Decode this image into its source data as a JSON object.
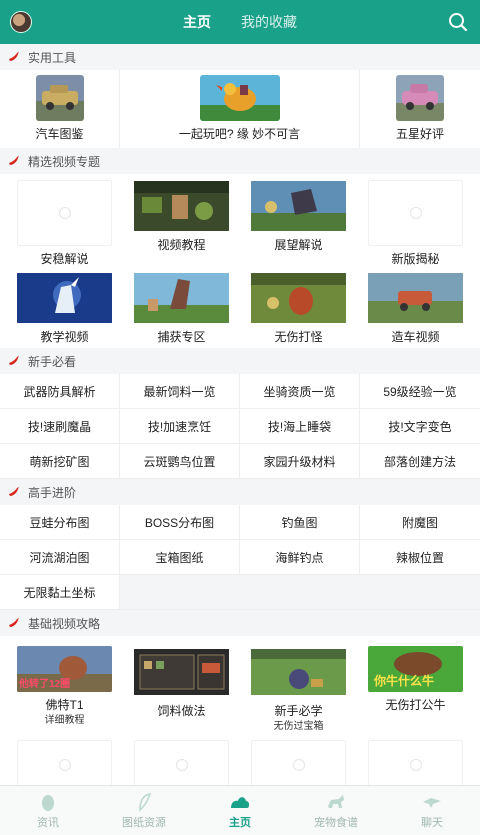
{
  "header": {
    "tabs": [
      {
        "label": "主页"
      },
      {
        "label": "我的收藏"
      }
    ]
  },
  "sections": {
    "tools": {
      "title": "实用工具",
      "items": [
        {
          "label": "汽车图鉴"
        },
        {
          "label": "一起玩吧? 缘 妙不可言"
        },
        {
          "label": "五星好评"
        }
      ]
    },
    "featured": {
      "title": "精选视频专题",
      "items": [
        {
          "label": "安稳解说"
        },
        {
          "label": "视频教程"
        },
        {
          "label": "展望解说"
        },
        {
          "label": "新版揭秘"
        },
        {
          "label": "教学视频"
        },
        {
          "label": "捕获专区"
        },
        {
          "label": "无伤打怪"
        },
        {
          "label": "造车视频"
        }
      ]
    },
    "newbie": {
      "title": "新手必看",
      "items": [
        {
          "label": "武器防具解析"
        },
        {
          "label": "最新饲料一览"
        },
        {
          "label": "坐骑资质一览"
        },
        {
          "label": "59级经验一览"
        },
        {
          "label": "技!速刷魔晶"
        },
        {
          "label": "技!加速烹饪"
        },
        {
          "label": "技!海上睡袋"
        },
        {
          "label": "技!文字变色"
        },
        {
          "label": "萌新挖矿图"
        },
        {
          "label": "云斑鹦鸟位置"
        },
        {
          "label": "家园升级材料"
        },
        {
          "label": "部落创建方法"
        }
      ]
    },
    "advanced": {
      "title": "高手进阶",
      "items": [
        {
          "label": "豆蛙分布图"
        },
        {
          "label": "BOSS分布图"
        },
        {
          "label": "钓鱼图"
        },
        {
          "label": "附魔图"
        },
        {
          "label": "河流湖泊图"
        },
        {
          "label": "宝箱图纸"
        },
        {
          "label": "海鲜钓点"
        },
        {
          "label": "辣椒位置"
        },
        {
          "label": "无限黏土坐标"
        }
      ]
    },
    "basic": {
      "title": "基础视频攻略",
      "items": [
        {
          "label": "佛特T1",
          "sub": "详细教程",
          "overlay": "他转了12圈"
        },
        {
          "label": "饲料做法",
          "sub": ""
        },
        {
          "label": "新手必学",
          "sub": "无伤过宝箱"
        },
        {
          "label": "无伤打公牛",
          "sub": "",
          "overlay": "你牛什么牛"
        }
      ]
    }
  },
  "bottom_nav": [
    {
      "label": "资讯"
    },
    {
      "label": "图纸资源"
    },
    {
      "label": "主页"
    },
    {
      "label": "宠物食谱"
    },
    {
      "label": "聊天"
    }
  ],
  "colors": {
    "brand": "#1aa189",
    "pepper": "#d6281f"
  }
}
